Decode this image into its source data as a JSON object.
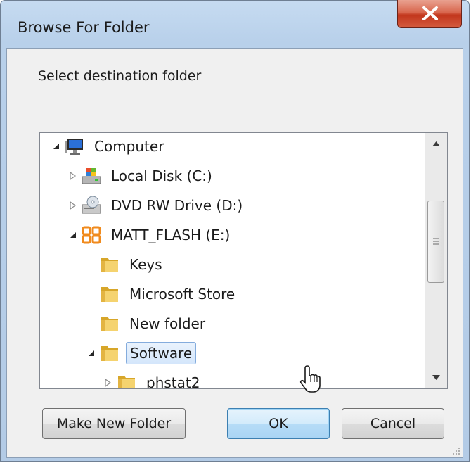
{
  "window": {
    "title": "Browse For Folder",
    "close_icon": "close-icon"
  },
  "dialog": {
    "instruction": "Select destination folder"
  },
  "tree": {
    "items": [
      {
        "label": "Computer",
        "icon": "computer-icon",
        "expander": "expanded"
      },
      {
        "label": "Local Disk (C:)",
        "icon": "local-disk-icon",
        "expander": "collapsed"
      },
      {
        "label": "DVD RW Drive (D:)",
        "icon": "dvd-drive-icon",
        "expander": "collapsed"
      },
      {
        "label": "MATT_FLASH (E:)",
        "icon": "flash-drive-icon",
        "expander": "expanded"
      },
      {
        "label": "Keys",
        "icon": "folder-icon",
        "expander": "none"
      },
      {
        "label": "Microsoft Store",
        "icon": "folder-icon",
        "expander": "none"
      },
      {
        "label": "New folder",
        "icon": "folder-icon",
        "expander": "none"
      },
      {
        "label": "Software",
        "icon": "folder-icon",
        "expander": "expanded",
        "selected": true
      },
      {
        "label": "phstat2",
        "icon": "folder-icon",
        "expander": "collapsed"
      }
    ]
  },
  "buttons": {
    "make_new_folder": "Make New Folder",
    "ok": "OK",
    "cancel": "Cancel"
  },
  "colors": {
    "frame": "#b8d0ea",
    "close_button": "#c7401f",
    "selection_border": "#84acdd",
    "default_button": "#b6dcf7"
  }
}
